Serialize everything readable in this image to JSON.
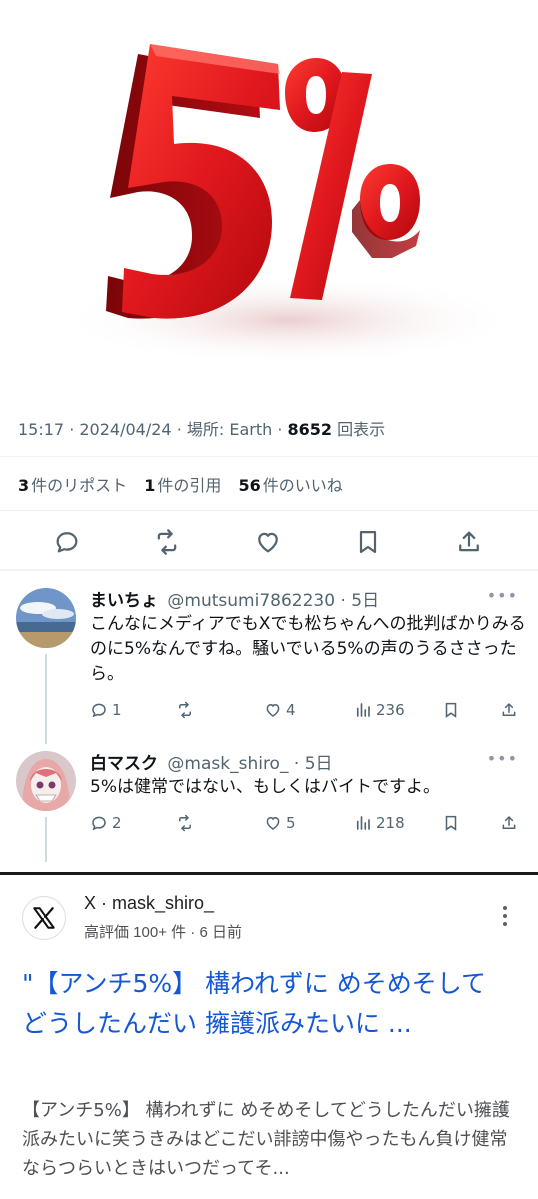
{
  "hero": {
    "text": "5%",
    "colors": {
      "main": "#e0181e",
      "dark": "#8e0d10",
      "light": "#ff5a5a"
    }
  },
  "tweet": {
    "time": "15:17",
    "date": "2024/04/24",
    "location_label": "場所: Earth",
    "views_count": "8652",
    "views_label": "回表示",
    "reposts_count": "3",
    "reposts_label": "件のリポスト",
    "quotes_count": "1",
    "quotes_label": "件の引用",
    "likes_count": "56",
    "likes_label": "件のいいね",
    "icons": [
      "reply-icon",
      "repost-icon",
      "like-icon",
      "bookmark-icon",
      "share-icon"
    ]
  },
  "replies": [
    {
      "name": "まいちょ",
      "handle": "@mutsumi7862230",
      "age": "5日",
      "text": "こんなにメディアでもXでも松ちゃんへの批判ばかりみるのに5%なんですね。騒いでいる5%の声のうるささったら。",
      "replies": "1",
      "reposts": "",
      "likes": "4",
      "views": "236"
    },
    {
      "name": "白マスク",
      "handle": "@mask_shiro_",
      "age": "5日",
      "text": "5%は健常ではない、もしくはバイトですよ。",
      "replies": "2",
      "reposts": "",
      "likes": "5",
      "views": "218"
    }
  ],
  "search_result": {
    "source": "X · mask_shiro_",
    "meta": "高評価 100+ 件 · 6 日前",
    "title": "\"【アンチ5%】 構われずに めそめそして どうしたんだい 擁護派みたいに ...",
    "snippet": "【アンチ5%】 構われずに めそめそしてどうしたんだい擁護派みたいに笑うきみはどこだい誹謗中傷やったもん負け健常ならつらいときはいつだってそ..."
  }
}
